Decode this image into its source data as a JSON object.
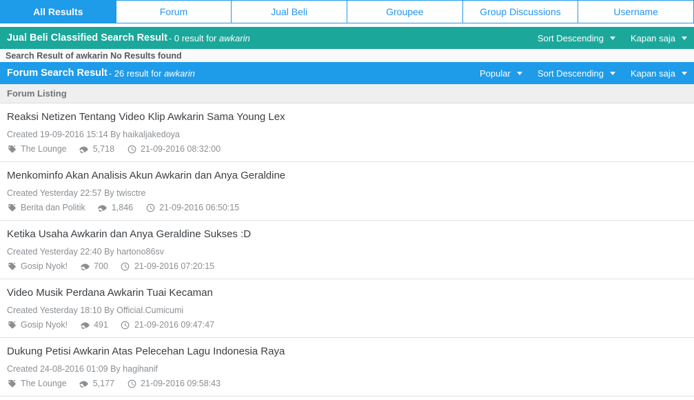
{
  "tabs": [
    {
      "label": "All Results",
      "active": true
    },
    {
      "label": "Forum",
      "active": false
    },
    {
      "label": "Jual Beli",
      "active": false
    },
    {
      "label": "Groupee",
      "active": false
    },
    {
      "label": "Group Discussions",
      "active": false
    },
    {
      "label": "Username",
      "active": false
    }
  ],
  "search_term": "awkarin",
  "classified_section": {
    "title": "Jual Beli Classified Search Result",
    "subtitle_prefix": "- 0 result for",
    "term": "awkarin",
    "bar_color": "#1ca79b",
    "controls": [
      {
        "label": "Sort Descending"
      },
      {
        "label": "Kapan saja"
      }
    ],
    "empty_message": "Search Result of awkarin No Results found"
  },
  "forum_section": {
    "title": "Forum Search Result",
    "subtitle_prefix": "- 26 result for",
    "term": "awkarin",
    "bar_color": "#1e9be9",
    "controls": [
      {
        "label": "Popular"
      },
      {
        "label": "Sort Descending"
      },
      {
        "label": "Kapan saja"
      }
    ],
    "listing_header": "Forum Listing",
    "results": [
      {
        "title": "Reaksi Netizen Tentang Video Klip Awkarin Sama Young Lex",
        "created": "Created 19-09-2016 15:14 By haikaljakedoya",
        "category": "The Lounge",
        "views": "5,718",
        "timestamp": "21-09-2016 08:32:00"
      },
      {
        "title": "Menkominfo Akan Analisis Akun Awkarin dan Anya Geraldine",
        "created": "Created Yesterday 22:57 By twisctre",
        "category": "Berita dan Politik",
        "views": "1,846",
        "timestamp": "21-09-2016 06:50:15"
      },
      {
        "title": "Ketika Usaha Awkarin dan Anya Geraldine Sukses :D",
        "created": "Created Yesterday 22:40 By hartono86sv",
        "category": "Gosip Nyok!",
        "views": "700",
        "timestamp": "21-09-2016 07:20:15"
      },
      {
        "title": "Video Musik Perdana Awkarin Tuai Kecaman",
        "created": "Created Yesterday 18:10 By Official.Cumicumi",
        "category": "Gosip Nyok!",
        "views": "491",
        "timestamp": "21-09-2016 09:47:47"
      },
      {
        "title": "Dukung Petisi Awkarin Atas Pelecehan Lagu Indonesia Raya",
        "created": "Created 24-08-2016 01:09 By hagihanif",
        "category": "The Lounge",
        "views": "5,177",
        "timestamp": "21-09-2016 09:58:43"
      }
    ]
  },
  "icons": {
    "tag": "tag-icon",
    "views": "eye-icon",
    "time": "clock-icon",
    "dropdown": "chevron-down-icon"
  }
}
